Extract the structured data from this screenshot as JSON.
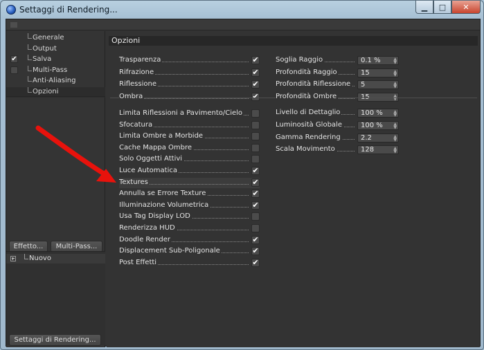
{
  "window": {
    "title": "Settaggi di Rendering..."
  },
  "window_buttons": {
    "minimize": "▁",
    "maximize": "□",
    "close": "✕"
  },
  "sidebar": {
    "items": [
      {
        "label": "Generale",
        "checkbox": false,
        "checked": false,
        "selected": false
      },
      {
        "label": "Output",
        "checkbox": false,
        "checked": false,
        "selected": false
      },
      {
        "label": "Salva",
        "checkbox": true,
        "checked": true,
        "selected": false
      },
      {
        "label": "Multi-Pass",
        "checkbox": true,
        "checked": false,
        "selected": false
      },
      {
        "label": "Anti-Aliasing",
        "checkbox": false,
        "checked": false,
        "selected": false
      },
      {
        "label": "Opzioni",
        "checkbox": false,
        "checked": false,
        "selected": true
      }
    ],
    "effect_button": "Effetto...",
    "multipass_button": "Multi-Pass...",
    "post_item": "Nuovo",
    "bottom_button": "Settaggi di Rendering..."
  },
  "options": {
    "section_title": "Opzioni",
    "group1_left": [
      {
        "label": "Trasparenza",
        "checked": true
      },
      {
        "label": "Rifrazione",
        "checked": true
      },
      {
        "label": "Riflessione",
        "checked": true
      },
      {
        "label": "Ombra",
        "checked": true
      }
    ],
    "group1_right": [
      {
        "label": "Soglia Raggio",
        "value": "0.1 %"
      },
      {
        "label": "Profondità Raggio",
        "value": "15"
      },
      {
        "label": "Profondità Riflessione",
        "value": "5"
      },
      {
        "label": "Profondità Ombre",
        "value": "15"
      }
    ],
    "group2_left": [
      {
        "label": "Limita Riflessioni a Pavimento/Cielo",
        "checked": false
      },
      {
        "label": "Sfocatura",
        "checked": false
      },
      {
        "label": "Limita Ombre a Morbide",
        "checked": false
      },
      {
        "label": "Cache Mappa Ombre",
        "checked": false
      },
      {
        "label": "Solo Oggetti Attivi",
        "checked": false
      },
      {
        "label": "Luce Automatica",
        "checked": true
      },
      {
        "label": "Textures",
        "checked": true,
        "highlight": true
      },
      {
        "label": "Annulla se Errore Texture",
        "checked": true
      },
      {
        "label": "Illuminazione Volumetrica",
        "checked": true
      },
      {
        "label": "Usa Tag Display LOD",
        "checked": false
      },
      {
        "label": "Renderizza HUD",
        "checked": false
      },
      {
        "label": "Doodle Render",
        "checked": true
      },
      {
        "label": "Displacement Sub-Poligonale",
        "checked": true
      },
      {
        "label": "Post Effetti",
        "checked": true
      }
    ],
    "group2_right": [
      {
        "label": "Livello di Dettaglio",
        "value": "100 %"
      },
      {
        "label": "Luminosità Globale",
        "value": "100 %"
      },
      {
        "label": "Gamma Rendering",
        "value": "2.2"
      },
      {
        "label": "Scala Movimento",
        "value": "128"
      }
    ]
  },
  "colors": {
    "panel": "#333333",
    "arrow": "#e8120c"
  }
}
